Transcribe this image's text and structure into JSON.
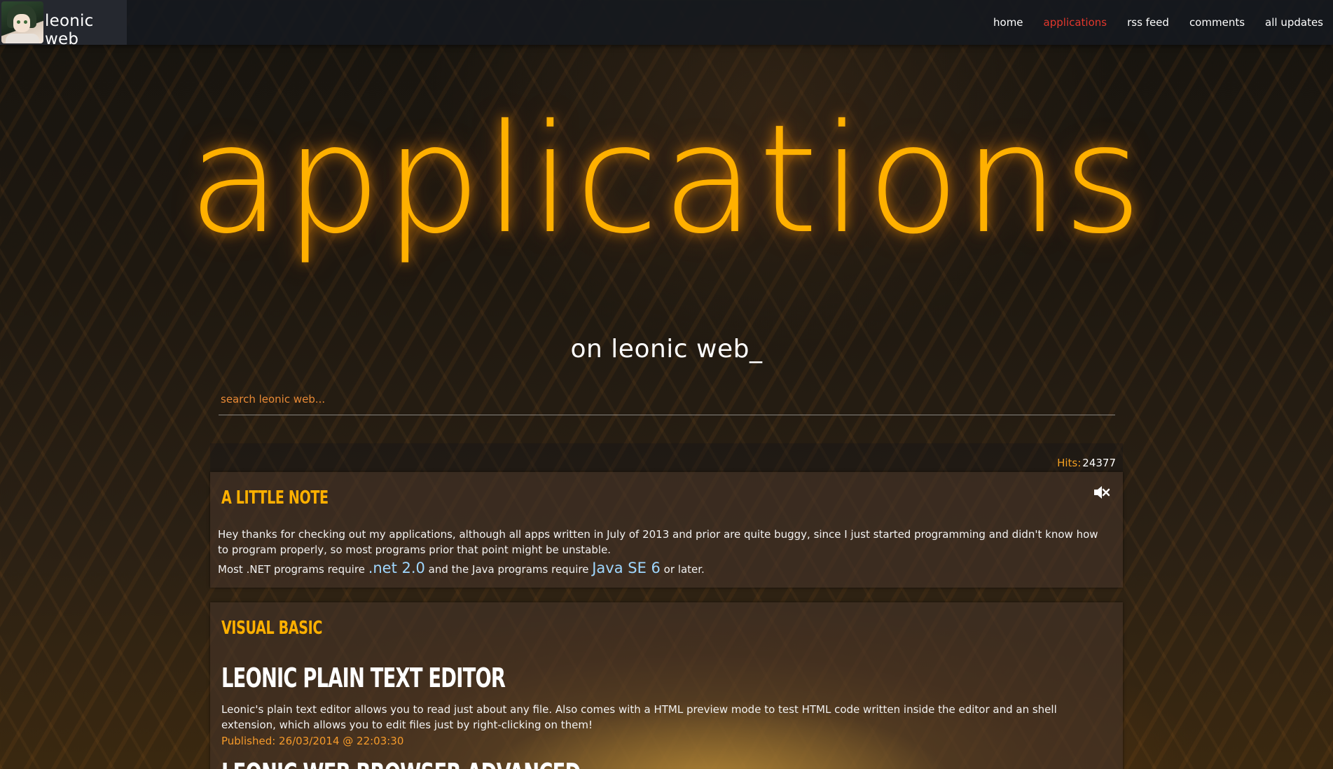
{
  "header": {
    "brand": "leonic web",
    "nav": [
      {
        "label": "home",
        "active": false
      },
      {
        "label": "applications",
        "active": true
      },
      {
        "label": "rss feed",
        "active": false
      },
      {
        "label": "comments",
        "active": false
      },
      {
        "label": "all updates",
        "active": false
      }
    ]
  },
  "hero": {
    "title": "applications",
    "subtitle": "on leonic web_"
  },
  "search": {
    "placeholder": "search leonic web..."
  },
  "hits": {
    "label": "Hits:",
    "value": "24377"
  },
  "note": {
    "heading": "A little note",
    "icon": "volume-mute-icon",
    "paragraph": "Hey thanks for checking out my applications, although all apps written in July of 2013 and prior are quite buggy, since I just started programming and didn't know how to program properly, so most programs prior that point might be unstable.",
    "requirements": {
      "prefix": "Most .NET programs require ",
      "dotnet": ".net 2.0",
      "middle": " and the Java programs require ",
      "java": "Java SE 6",
      "suffix": " or later."
    }
  },
  "visual_basic": {
    "heading": "Visual Basic",
    "apps": [
      {
        "title": "Leonic Plain Text Editor",
        "description": "Leonic's plain text editor allows you to read just about any file. Also comes with a HTML preview mode to test HTML code written inside the editor and an shell extension, which allows you to edit files just by right-clicking on them!",
        "published": "Published: 26/03/2014 @ 22:03:30"
      },
      {
        "title": "Leonic Web Browser Advanced"
      }
    ]
  },
  "colors": {
    "accent": "#ffb000",
    "active_nav": "#e2372c",
    "link": "#9fd7ff",
    "published": "#f59a2a"
  }
}
